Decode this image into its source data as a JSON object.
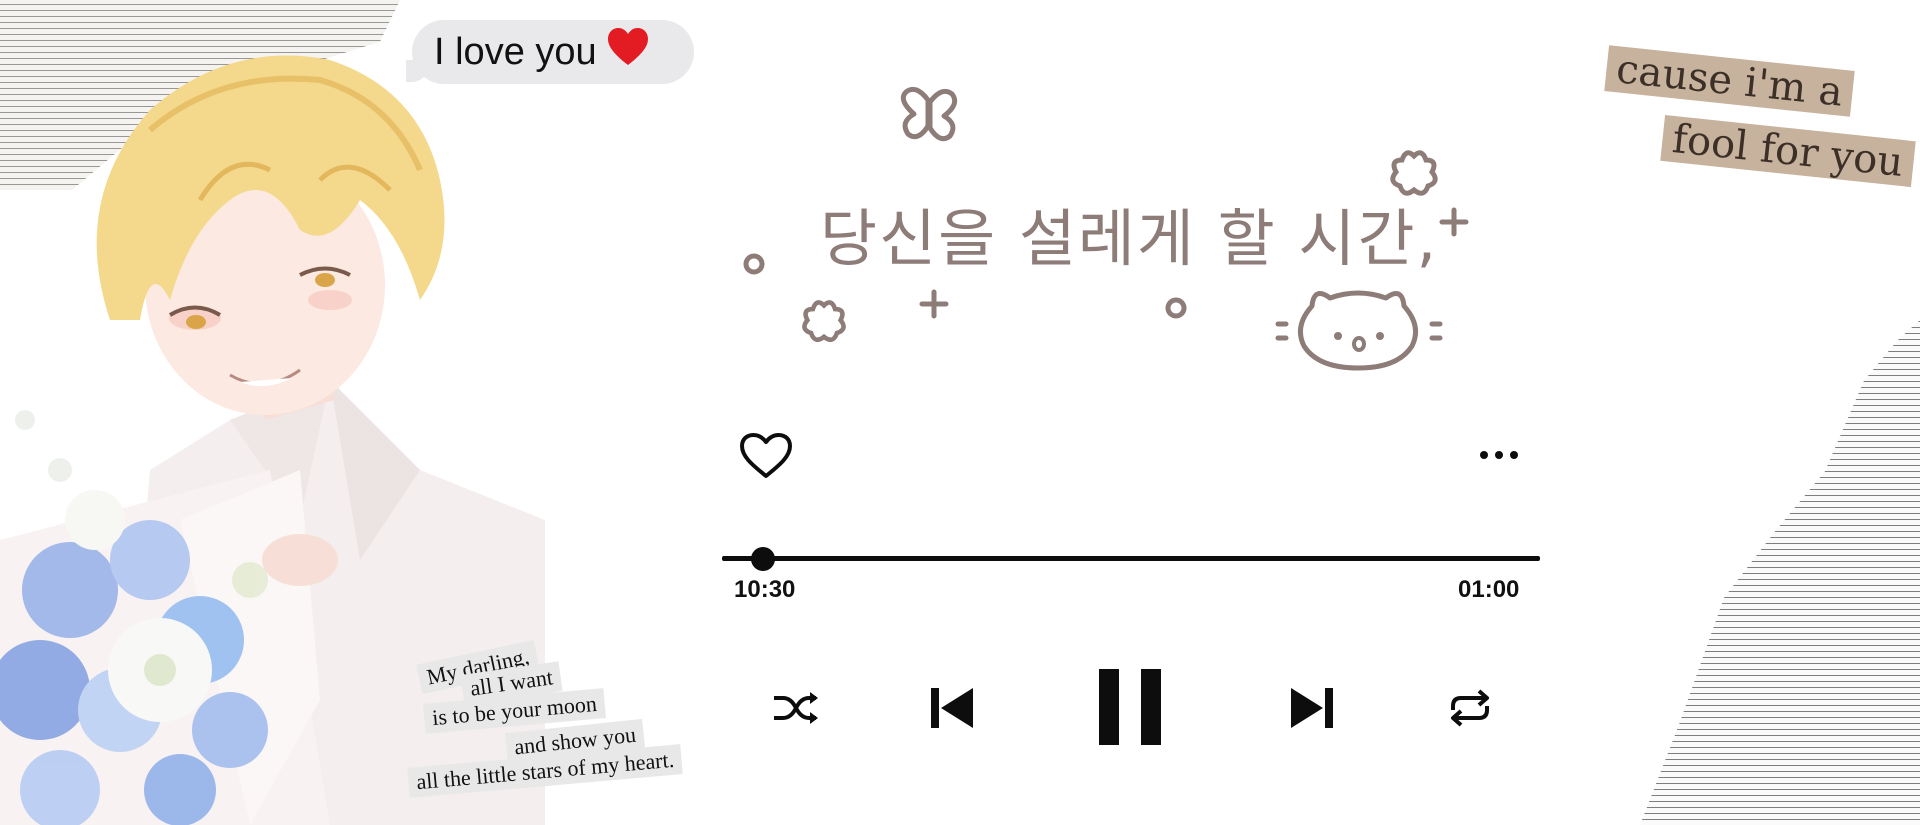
{
  "bubble": {
    "text": "I love you",
    "emoji": "❤️"
  },
  "poem": [
    "My darling,",
    "all I want",
    "is to be your moon",
    "and show you",
    "all the little stars of my heart."
  ],
  "quote": [
    "cause i'm a",
    "fool for you"
  ],
  "title": "당신을 설레게 할 시간,",
  "player": {
    "elapsed": "10:30",
    "duration": "01:00",
    "progress_fraction": 0.05,
    "state": "playing"
  },
  "icons": {
    "like": "heart-outline-icon",
    "more": "more-horizontal-icon",
    "shuffle": "shuffle-icon",
    "previous": "skip-previous-icon",
    "pause": "pause-icon",
    "next": "skip-next-icon",
    "repeat": "repeat-icon"
  },
  "colors": {
    "doodle": "#8d7c78",
    "controls": "#0d0d0d",
    "tape": "#c7b29d"
  }
}
